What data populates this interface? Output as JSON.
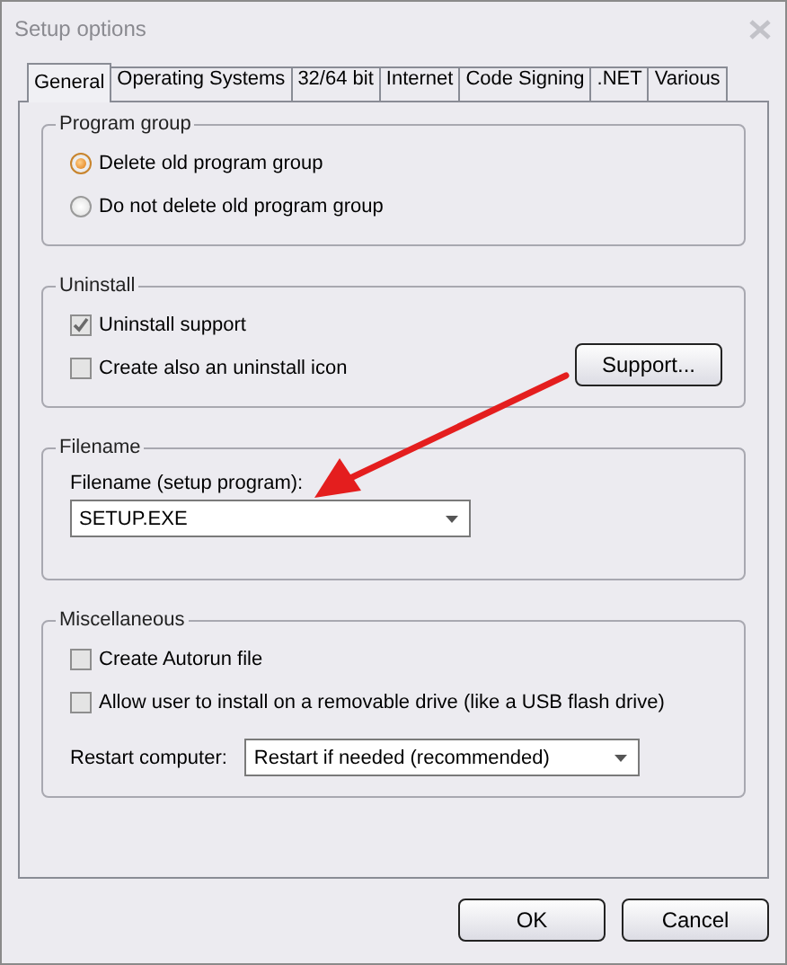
{
  "window": {
    "title": "Setup options"
  },
  "tabs": [
    {
      "label": "General",
      "selected": true
    },
    {
      "label": "Operating Systems",
      "selected": false
    },
    {
      "label": "32/64 bit",
      "selected": false
    },
    {
      "label": "Internet",
      "selected": false
    },
    {
      "label": "Code Signing",
      "selected": false
    },
    {
      "label": ".NET",
      "selected": false
    },
    {
      "label": "Various",
      "selected": false
    }
  ],
  "groups": [
    {
      "title": "Program group",
      "items": [
        {
          "kind": "radio",
          "label": "Delete old program group",
          "selected": true
        },
        {
          "kind": "radio",
          "label": "Do not delete old program group",
          "selected": false
        }
      ]
    },
    {
      "title": "Uninstall",
      "items": [
        {
          "kind": "checkbox",
          "label": "Uninstall support",
          "checked": true
        },
        {
          "kind": "checkbox",
          "label": "Create also an uninstall icon",
          "checked": false
        }
      ],
      "button": "Support..."
    },
    {
      "title": "Filename",
      "items": [
        {
          "kind": "combo",
          "label": "Filename (setup program):",
          "value": "SETUP.EXE"
        }
      ]
    },
    {
      "title": "Miscellaneous",
      "items": [
        {
          "kind": "checkbox",
          "label": "Create Autorun file",
          "checked": false
        },
        {
          "kind": "checkbox",
          "label": "Allow user to install on a removable drive (like a USB flash drive)",
          "checked": false
        },
        {
          "kind": "inline-combo",
          "label": "Restart computer:",
          "value": "Restart if needed (recommended)"
        }
      ]
    }
  ],
  "buttons": [
    "OK",
    "Cancel"
  ]
}
